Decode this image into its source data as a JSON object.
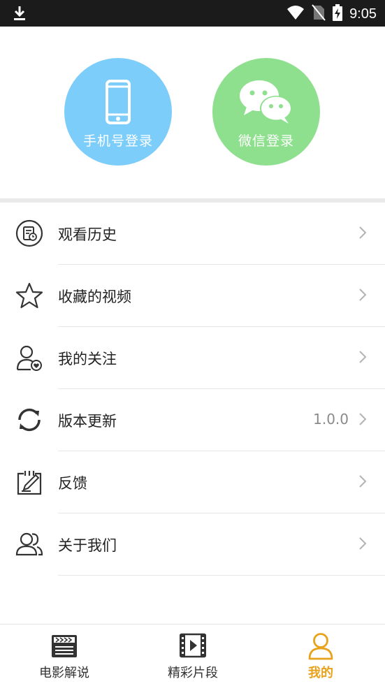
{
  "status_bar": {
    "time": "9:05"
  },
  "login": {
    "phone_label": "手机号登录",
    "wechat_label": "微信登录",
    "phone_color": "#7ccdfa",
    "wechat_color": "#8ee08e"
  },
  "menu": {
    "items": [
      {
        "label": "观看历史",
        "icon": "history-icon"
      },
      {
        "label": "收藏的视频",
        "icon": "star-icon"
      },
      {
        "label": "我的关注",
        "icon": "follow-user-icon"
      },
      {
        "label": "版本更新",
        "icon": "refresh-icon",
        "value": "1.0.0"
      },
      {
        "label": "反馈",
        "icon": "feedback-edit-icon"
      },
      {
        "label": "关于我们",
        "icon": "group-icon"
      }
    ]
  },
  "bottom_nav": {
    "active_color": "#e8a21c",
    "tabs": [
      {
        "label": "电影解说",
        "icon": "clapperboard-icon"
      },
      {
        "label": "精彩片段",
        "icon": "film-play-icon"
      },
      {
        "label": "我的",
        "icon": "person-icon",
        "active": true
      }
    ]
  }
}
